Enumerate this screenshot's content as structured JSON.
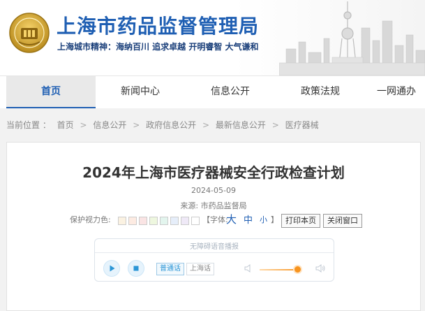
{
  "header": {
    "title": "上海市药品监督管理局",
    "slogan": "上海城市精神：海纳百川  追求卓越  开明睿智  大气谦和",
    "emblem_icon": "shanghai-emblem-icon",
    "skyline_image": "city-skyline"
  },
  "nav": {
    "items": [
      {
        "label": "首页",
        "active": true
      },
      {
        "label": "新闻中心",
        "active": false
      },
      {
        "label": "信息公开",
        "active": false
      },
      {
        "label": "政策法规",
        "active": false
      },
      {
        "label": "一网通办",
        "active": false
      }
    ]
  },
  "breadcrumb": {
    "prefix": "当前位置 ：",
    "items": [
      "首页",
      "信息公开",
      "政府信息公开",
      "最新信息公开",
      "医疗器械"
    ],
    "separator": ">"
  },
  "article": {
    "title": "2024年上海市医疗器械安全行政检查计划",
    "date": "2024-05-09",
    "source": "来源:  市药品监督局",
    "tools": {
      "eye_care_label": "保护视力色:",
      "eye_colors": [
        "#fbf2e2",
        "#fdebe2",
        "#fae4e4",
        "#eef7df",
        "#e3f5ee",
        "#e6eefa",
        "#efe9f7",
        "#ffffff"
      ],
      "font_label": "【字体:",
      "font_large": "大",
      "font_medium": "中",
      "font_small": "小",
      "font_close": "】",
      "print_button": "打印本页",
      "close_button": "关闭窗口"
    }
  },
  "player": {
    "title": "无障碍语音播报",
    "lang_mandarin": "普通话",
    "lang_shanghai": "上海话",
    "volume_level": 0.9,
    "accent": "#2a95d6"
  }
}
